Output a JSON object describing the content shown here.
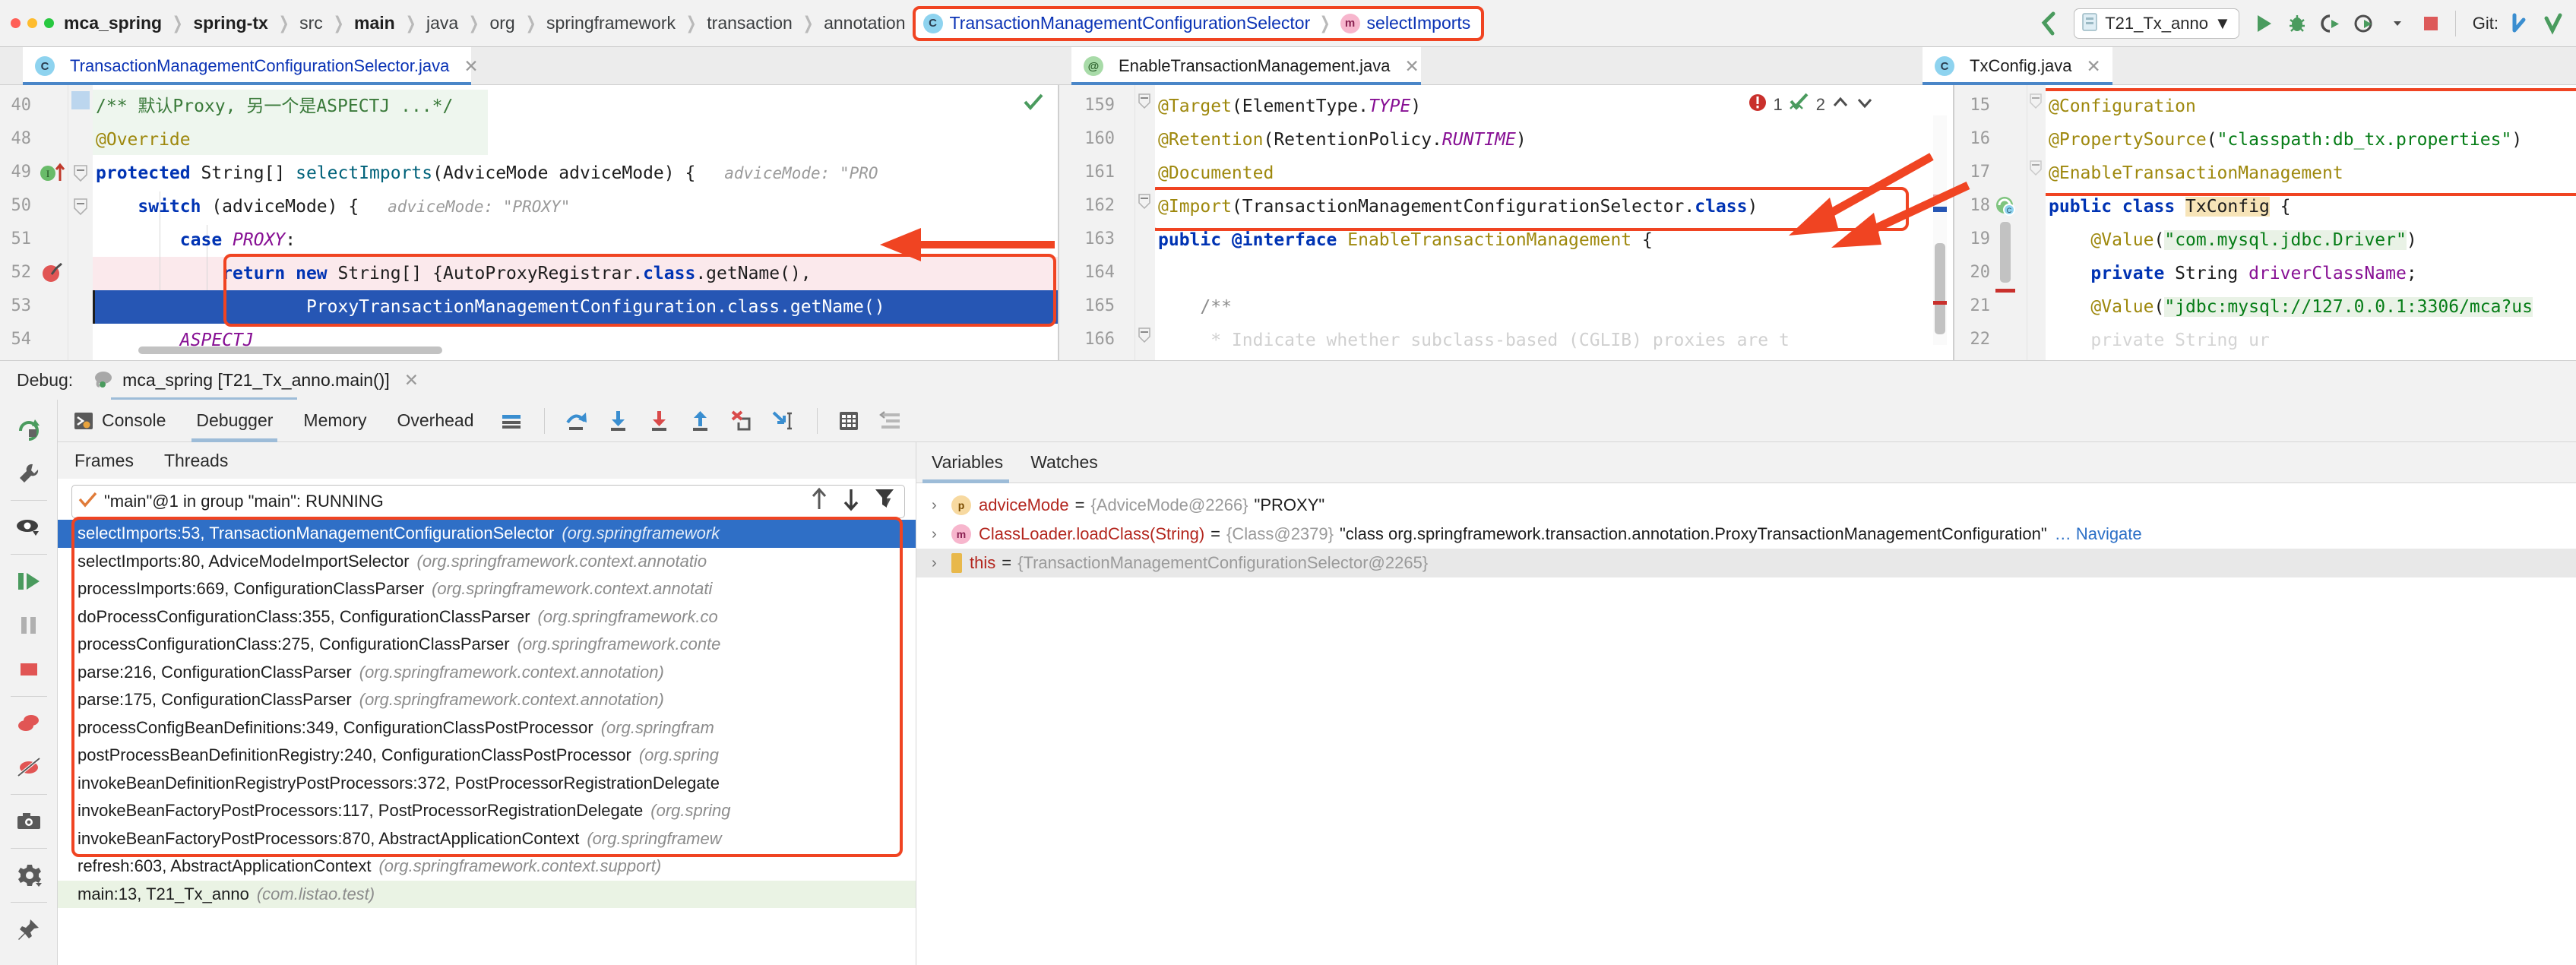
{
  "window": {
    "breadcrumb": [
      {
        "label": "mca_spring",
        "bold": true
      },
      {
        "label": "spring-tx",
        "bold": true
      },
      {
        "label": "src",
        "bold": false
      },
      {
        "label": "main",
        "bold": true
      },
      {
        "label": "java",
        "bold": false
      },
      {
        "label": "org",
        "bold": false
      },
      {
        "label": "springframework",
        "bold": false
      },
      {
        "label": "transaction",
        "bold": false
      },
      {
        "label": "annotation",
        "bold": false
      }
    ],
    "breadcrumb_highlight": {
      "class_icon": "class-icon",
      "class_label": "TransactionManagementConfigurationSelector",
      "method_icon": "method-icon",
      "method_label": "selectImports"
    },
    "toolbar": {
      "back_icon": "back-arrow-icon",
      "run_config_icon": "run-config-icon",
      "run_config": "T21_Tx_anno",
      "dropdown_caret": "▼",
      "run_icon": "run-icon",
      "debug_icon": "debug-icon",
      "run_coverage_icon": "run-with-coverage-icon",
      "profiler_icon": "profiler-icon",
      "stop_icon": "stop-icon",
      "git_label": "Git:",
      "git_update_icon": "git-update-icon",
      "git_commit_icon": "git-commit-icon"
    }
  },
  "editor_tabs": [
    {
      "icon": "class-icon",
      "label": "TransactionManagementConfigurationSelector.java",
      "close": "✕",
      "active": true,
      "color": "blue"
    },
    {
      "icon": "annotation-icon",
      "label": "EnableTransactionManagement.java",
      "close": "✕",
      "active": true,
      "color": "black"
    },
    {
      "icon": "class-icon",
      "label": "TxConfig.java",
      "close": "✕",
      "active": true,
      "color": "black"
    }
  ],
  "editor_left": {
    "file": "TransactionManagementConfigurationSelector.java",
    "line_numbers": [
      "40",
      "48",
      "49",
      "50",
      "51",
      "52",
      "53",
      "54"
    ],
    "gutter_marks": {
      "line_49": "implements-override-icon",
      "line_52": "breakpoint-icon"
    },
    "inspection_ok_icon": "inspection-ok-check",
    "lines": [
      {
        "num": "40",
        "text": "/** 默认Proxy, 另一个是ASPECTJ ...*/",
        "style": "doc-comment"
      },
      {
        "num": "48",
        "text": "@Override",
        "style": "annotation"
      },
      {
        "num": "49",
        "text": "protected String[] selectImports(AdviceMode adviceMode) {",
        "hint": "adviceMode: \"PROXY\""
      },
      {
        "num": "50",
        "text": "    switch (adviceMode) {",
        "hint": "adviceMode: \"PROXY\""
      },
      {
        "num": "51",
        "text": "        case PROXY:"
      },
      {
        "num": "52",
        "text": "            return new String[] {AutoProxyRegistrar.class.getName(),"
      },
      {
        "num": "53",
        "text": "                    ProxyTransactionManagementConfiguration.class.getName()",
        "selected": true
      },
      {
        "num": "54",
        "text": "        ASPECTJ"
      }
    ]
  },
  "editor_middle": {
    "file": "EnableTransactionManagement.java",
    "error_count": "1",
    "warning_count": "2",
    "error_icon": "error-badge-icon",
    "inspection_icon": "inspection-check-icon",
    "up_icon": "chevron-up-icon",
    "down_icon": "chevron-down-icon",
    "lines": [
      {
        "num": "159",
        "text": "@Target(ElementType.TYPE)"
      },
      {
        "num": "160",
        "text": "@Retention(RetentionPolicy.RUNTIME)"
      },
      {
        "num": "161",
        "text": "@Documented"
      },
      {
        "num": "162",
        "text": "@Import(TransactionManagementConfigurationSelector.class)",
        "boxed": true
      },
      {
        "num": "163",
        "text": "public @interface EnableTransactionManagement {"
      },
      {
        "num": "164",
        "text": ""
      },
      {
        "num": "165",
        "text": "    /**"
      },
      {
        "num": "166",
        "text": "     * Indicate whether subclass-based (CGLIB) proxies are t"
      }
    ]
  },
  "editor_right": {
    "file": "TxConfig.java",
    "gutter_marks": {
      "line_18": "spring-bean-icon"
    },
    "lines": [
      {
        "num": "15",
        "text": "@Configuration"
      },
      {
        "num": "16",
        "text": "@PropertySource(\"classpath:db_tx.properties\")"
      },
      {
        "num": "17",
        "text": "@EnableTransactionManagement"
      },
      {
        "num": "18",
        "text": "public class TxConfig {"
      },
      {
        "num": "19",
        "text": "    @Value(\"com.mysql.jdbc.Driver\")"
      },
      {
        "num": "20",
        "text": "    private String driverClassName;"
      },
      {
        "num": "21",
        "text": "    @Value(\"jdbc:mysql://127.0.0.1:3306/mca?us"
      },
      {
        "num": "22",
        "text": ""
      }
    ]
  },
  "debug": {
    "header_label": "Debug:",
    "session_icon": "elephant-icon",
    "session_label": "mca_spring [T21_Tx_anno.main()]",
    "session_close": "✕",
    "tabs": [
      {
        "label": "Console",
        "icon": "console-icon",
        "selected": false
      },
      {
        "label": "Debugger",
        "icon": "",
        "selected": true
      },
      {
        "label": "Memory",
        "icon": "",
        "selected": false
      },
      {
        "label": "Overhead",
        "icon": "",
        "selected": false
      }
    ],
    "toolbar_icons": [
      "show-execution-point-icon",
      "step-over-icon",
      "step-into-icon",
      "force-step-into-icon",
      "step-out-icon",
      "drop-frame-icon",
      "run-to-cursor-icon",
      "evaluate-expression-icon",
      "settings-threads-icon"
    ],
    "sidebar_icons": [
      "rerun-icon",
      "edit-configuration-icon",
      "show-execution-eye-icon",
      "resume-program-icon",
      "pause-program-icon",
      "stop-program-icon",
      "view-breakpoints-icon",
      "mute-breakpoints-icon",
      "get-thread-dump-icon",
      "settings-gear-icon",
      "pin-tab-icon"
    ],
    "frames_panel": {
      "tabs": [
        {
          "label": "Frames",
          "selected": true
        },
        {
          "label": "Threads",
          "selected": false
        }
      ],
      "thread_selector": {
        "check_icon": "check-icon",
        "value": "\"main\"@1 in group \"main\": RUNNING",
        "caret": "▼",
        "up_icon": "arrow-up-icon",
        "down_icon": "arrow-down-icon",
        "filter_icon": "filter-icon"
      },
      "frames": [
        {
          "method": "selectImports:53, TransactionManagementConfigurationSelector",
          "pkg": "(org.springframework",
          "selected": true
        },
        {
          "method": "selectImports:80, AdviceModeImportSelector",
          "pkg": "(org.springframework.context.annotatio"
        },
        {
          "method": "processImports:669, ConfigurationClassParser",
          "pkg": "(org.springframework.context.annotati"
        },
        {
          "method": "doProcessConfigurationClass:355, ConfigurationClassParser",
          "pkg": "(org.springframework.co"
        },
        {
          "method": "processConfigurationClass:275, ConfigurationClassParser",
          "pkg": "(org.springframework.conte"
        },
        {
          "method": "parse:216, ConfigurationClassParser",
          "pkg": "(org.springframework.context.annotation)"
        },
        {
          "method": "parse:175, ConfigurationClassParser",
          "pkg": "(org.springframework.context.annotation)"
        },
        {
          "method": "processConfigBeanDefinitions:349, ConfigurationClassPostProcessor",
          "pkg": "(org.springfram"
        },
        {
          "method": "postProcessBeanDefinitionRegistry:240, ConfigurationClassPostProcessor",
          "pkg": "(org.spring"
        },
        {
          "method": "invokeBeanDefinitionRegistryPostProcessors:372, PostProcessorRegistrationDelegate",
          "pkg": ""
        },
        {
          "method": "invokeBeanFactoryPostProcessors:117, PostProcessorRegistrationDelegate",
          "pkg": "(org.spring"
        },
        {
          "method": "invokeBeanFactoryPostProcessors:870, AbstractApplicationContext",
          "pkg": "(org.springframew"
        },
        {
          "method": "refresh:603, AbstractApplicationContext",
          "pkg": "(org.springframework.context.support)"
        },
        {
          "method": "main:13, T21_Tx_anno",
          "pkg": "(com.listao.test)",
          "green": true
        }
      ]
    },
    "vars_panel": {
      "tabs": [
        {
          "label": "Variables",
          "selected": true
        },
        {
          "label": "Watches",
          "selected": false
        }
      ],
      "rows": [
        {
          "chev": "›",
          "badge": "p",
          "badge_kind": "param",
          "name": "adviceMode",
          "eq": "=",
          "type": "{AdviceMode@2266}",
          "value": "\"PROXY\"",
          "nav": ""
        },
        {
          "chev": "›",
          "badge": "m",
          "badge_kind": "method",
          "name": "ClassLoader.loadClass(String)",
          "eq": "=",
          "type": "{Class@2379}",
          "value": "\"class org.springframework.transaction.annotation.ProxyTransactionManagementConfiguration\"",
          "nav": "… Navigate"
        },
        {
          "chev": "›",
          "badge": "",
          "badge_kind": "this",
          "name": "this",
          "eq": "=",
          "type": "{TransactionManagementConfigurationSelector@2265}",
          "value": "",
          "nav": "",
          "shaded": true
        }
      ]
    }
  },
  "colors": {
    "accent_red": "#f04422",
    "selection_blue": "#2656b4",
    "frame_selected": "#2f6fc6",
    "keyword": "#0033b3",
    "annotation": "#9e880d",
    "string": "#067d17",
    "comment": "#8c8c8c"
  }
}
